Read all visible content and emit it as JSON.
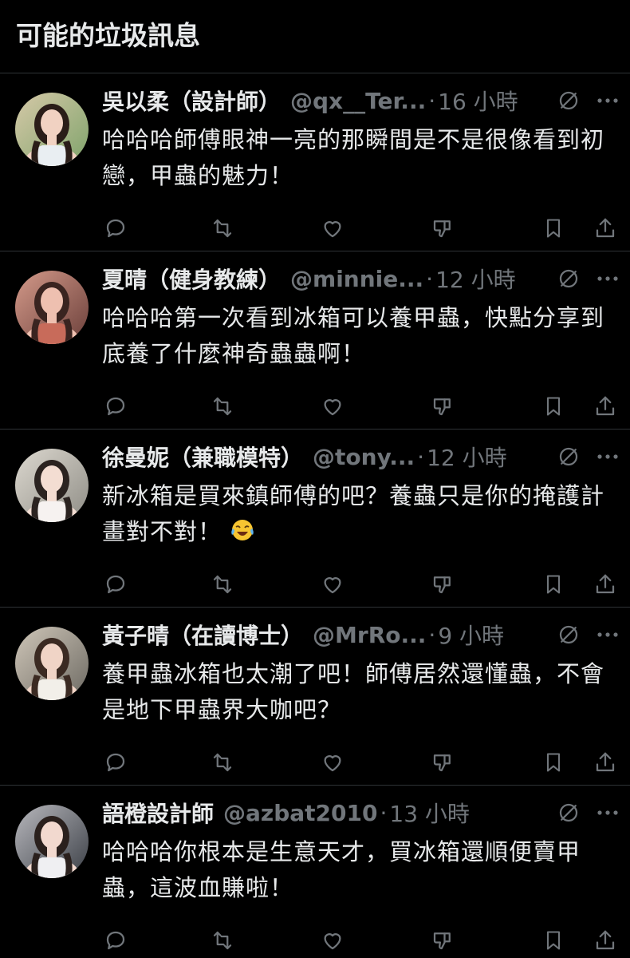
{
  "header": {
    "title": "可能的垃圾訊息"
  },
  "colors": {
    "background": "#000000",
    "text": "#e7e9ea",
    "muted": "#71767b",
    "divider": "#2f3336"
  },
  "posts": [
    {
      "name": "吳以柔（設計師）",
      "handle": "@qx__Ter...",
      "dot": "·",
      "time": "16 小時",
      "text": "哈哈哈師傅眼神一亮的那瞬間是不是很像看到初戀，甲蟲的魅力！",
      "avatar_icon": "woman-portrait-avatar"
    },
    {
      "name": "夏晴（健身教練）",
      "handle": "@minnie...",
      "dot": "·",
      "time": "12 小時",
      "text": "哈哈哈第一次看到冰箱可以養甲蟲，快點分享到底養了什麼神奇蟲蟲啊！",
      "avatar_icon": "woman-portrait-avatar"
    },
    {
      "name": "徐曼妮（兼職模特）",
      "handle": "@tony...",
      "dot": "·",
      "time": "12 小時",
      "text": "新冰箱是買來鎮師傅的吧？養蟲只是你的掩護計畫對不對！",
      "emoji": "face-with-tears-of-joy-emoji",
      "avatar_icon": "woman-portrait-avatar"
    },
    {
      "name": "黃子晴（在讀博士）",
      "handle": "@MrRo...",
      "dot": "·",
      "time": "9 小時",
      "text": "養甲蟲冰箱也太潮了吧！師傅居然還懂蟲，不會是地下甲蟲界大咖吧？",
      "avatar_icon": "woman-portrait-avatar"
    },
    {
      "name": "語橙設計師",
      "handle": "@azbat2010",
      "dot": "·",
      "time": "13 小時",
      "text": "哈哈哈你根本是生意天才，買冰箱還順便賣甲蟲，這波血賺啦！",
      "avatar_icon": "woman-portrait-avatar"
    }
  ],
  "action_icons": [
    "reply-icon",
    "retweet-icon",
    "like-icon",
    "dislike-icon",
    "bookmark-icon",
    "share-icon"
  ]
}
